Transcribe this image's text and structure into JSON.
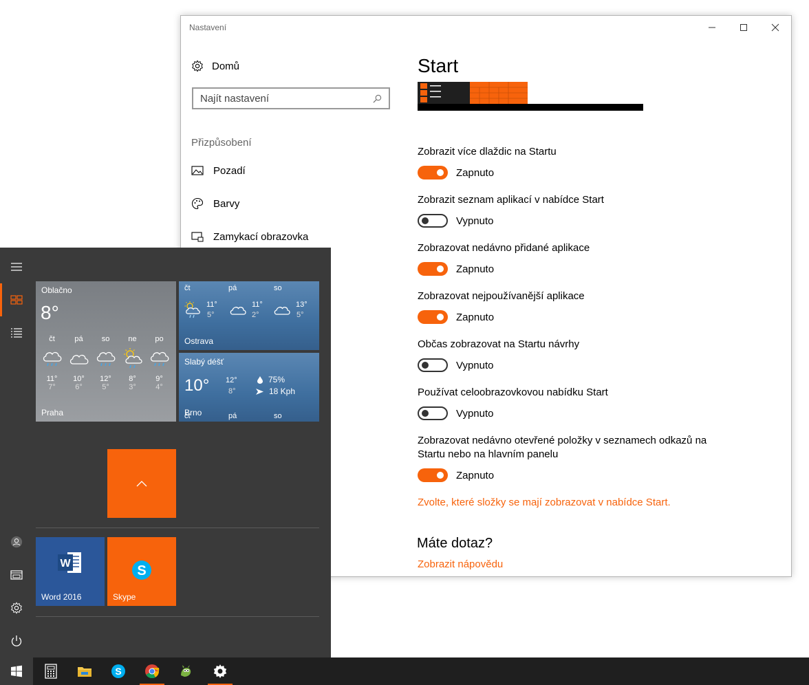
{
  "settings": {
    "window_title": "Nastavení",
    "nav": {
      "home": "Domů",
      "search_placeholder": "Najít nastavení",
      "section": "Přizpůsobení",
      "items": [
        {
          "label": "Pozadí",
          "icon": "picture-icon"
        },
        {
          "label": "Barvy",
          "icon": "palette-icon"
        },
        {
          "label": "Zamykací obrazovka",
          "icon": "lock-screen-icon"
        }
      ]
    },
    "page_title": "Start",
    "options": [
      {
        "label": "Zobrazit více dlaždic na Startu",
        "state": "Zapnuto",
        "on": true
      },
      {
        "label": "Zobrazit seznam aplikací v nabídce Start",
        "state": "Vypnuto",
        "on": false
      },
      {
        "label": "Zobrazovat nedávno přidané aplikace",
        "state": "Zapnuto",
        "on": true
      },
      {
        "label": "Zobrazovat nejpoužívanější aplikace",
        "state": "Zapnuto",
        "on": true
      },
      {
        "label": "Občas zobrazovat na Startu návrhy",
        "state": "Vypnuto",
        "on": false
      },
      {
        "label": "Používat celoobrazovkovou nabídku Start",
        "state": "Vypnuto",
        "on": false
      },
      {
        "label": "Zobrazovat nedávno otevřené položky v seznamech odkazů na Startu nebo na hlavním panelu",
        "state": "Zapnuto",
        "on": true
      }
    ],
    "folders_link": "Zvolte, které složky se mají zobrazovat v nabídce Start.",
    "help_title": "Máte dotaz?",
    "help_link": "Zobrazit nápovědu"
  },
  "start_menu": {
    "weather_large": {
      "condition": "Oblačno",
      "temp": "8°",
      "city": "Praha",
      "days": [
        {
          "day": "čt",
          "hi": "11°",
          "lo": "7°",
          "icon": "rain-icon"
        },
        {
          "day": "pá",
          "hi": "10°",
          "lo": "6°",
          "icon": "cloud-icon"
        },
        {
          "day": "so",
          "hi": "12°",
          "lo": "5°",
          "icon": "rain-icon"
        },
        {
          "day": "ne",
          "hi": "8°",
          "lo": "3°",
          "icon": "sun-rain-icon"
        },
        {
          "day": "po",
          "hi": "9°",
          "lo": "4°",
          "icon": "rain-icon"
        }
      ]
    },
    "weather_small": {
      "city": "Ostrava",
      "days": [
        {
          "day": "čt",
          "hi": "11°",
          "lo": "5°",
          "icon": "sun-rain-icon"
        },
        {
          "day": "pá",
          "hi": "11°",
          "lo": "2°",
          "icon": "cloud-icon"
        },
        {
          "day": "so",
          "hi": "13°",
          "lo": "5°",
          "icon": "cloud-icon"
        }
      ]
    },
    "weather_live": {
      "condition": "Slabý déšť",
      "temp": "10°",
      "hi": "12°",
      "lo": "8°",
      "humidity": "75%",
      "wind": "18 Kph",
      "city": "Brno",
      "days": [
        "čt",
        "pá",
        "so"
      ]
    },
    "tiles": [
      {
        "label": "Word 2016",
        "color": "#2b579a"
      },
      {
        "label": "Skype",
        "color": "#f7630c"
      }
    ],
    "accent": "#f7630c"
  },
  "taskbar": {
    "items": [
      "start-icon",
      "calculator-icon",
      "file-explorer-icon",
      "skype-icon",
      "chrome-icon",
      "app-icon",
      "settings-icon"
    ]
  }
}
